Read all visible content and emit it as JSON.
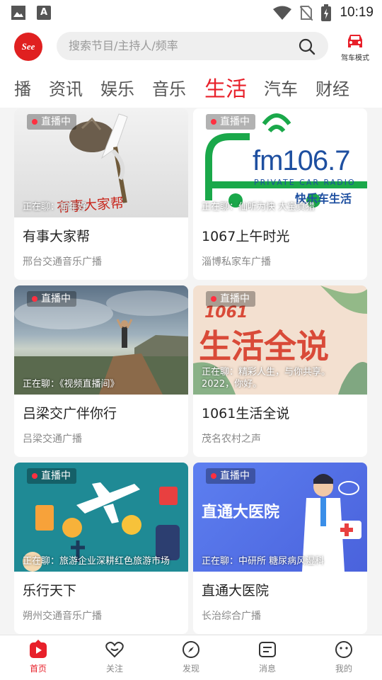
{
  "status_bar": {
    "time": "10:19",
    "icons": [
      "gallery-icon",
      "a-icon",
      "wifi-icon",
      "no-sim-icon",
      "battery-icon"
    ]
  },
  "header": {
    "logo_text": "See",
    "search_placeholder": "搜索节目/主持人/频率",
    "drive_mode_label": "驾车模式"
  },
  "tabs": [
    {
      "label": "播"
    },
    {
      "label": "资讯"
    },
    {
      "label": "娱乐"
    },
    {
      "label": "音乐"
    },
    {
      "label": "生活",
      "active": true
    },
    {
      "label": "汽车"
    },
    {
      "label": "财经"
    }
  ],
  "cards": [
    {
      "live": "直播中",
      "now_playing": "正在聊：新年好",
      "title": "有事大家帮",
      "station": "邢台交通音乐广播",
      "thumb_text": "有事大家帮"
    },
    {
      "live": "直播中",
      "now_playing": "正在聊：仙听为快 大宝真猎",
      "title": "1067上午时光",
      "station": "淄博私家车广播",
      "thumb_text": "fm106.7",
      "thumb_sub": "PRIVATE CAR RADIO",
      "thumb_sub2": "快乐车生活"
    },
    {
      "live": "直播中",
      "now_playing": "正在聊：《视频直播间》",
      "title": "吕梁交广伴你行",
      "station": "吕梁交通广播"
    },
    {
      "live": "直播中",
      "now_playing": "正在聊：精彩人生，与你共享。2022，你好。",
      "title": "1061生活全说",
      "station": "茂名农村之声",
      "thumb_text": "生活全说",
      "thumb_num": "1061"
    },
    {
      "live": "直播中",
      "now_playing": "正在聊：旅游企业深耕红色旅游市场",
      "title": "乐行天下",
      "station": "朔州交通音乐广播"
    },
    {
      "live": "直播中",
      "now_playing": "正在聊：中研所 糖尿病风湿科",
      "title": "直通大医院",
      "station": "长治综合广播",
      "thumb_text": "直通大医院"
    }
  ],
  "bottom_nav": [
    {
      "label": "首页",
      "icon": "home-icon",
      "active": true
    },
    {
      "label": "关注",
      "icon": "heart-icon"
    },
    {
      "label": "发现",
      "icon": "compass-icon"
    },
    {
      "label": "消息",
      "icon": "message-icon"
    },
    {
      "label": "我的",
      "icon": "profile-icon"
    }
  ]
}
